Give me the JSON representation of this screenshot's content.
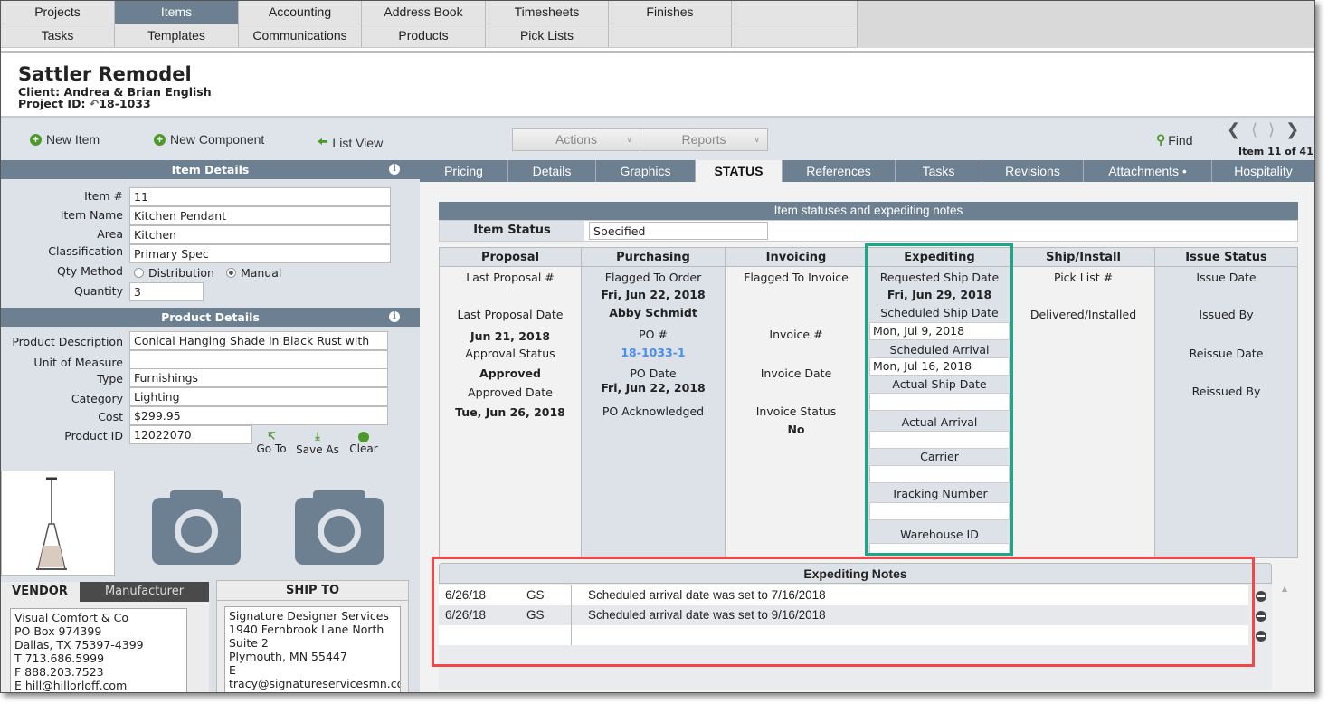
{
  "nav": {
    "row1": [
      "Projects",
      "Items",
      "Accounting",
      "Address Book",
      "Timesheets",
      "Finishes",
      ""
    ],
    "row2": [
      "Tasks",
      "Templates",
      "Communications",
      "Products",
      "Pick Lists",
      "",
      ""
    ],
    "active": "Items"
  },
  "header": {
    "title": "Sattler Remodel",
    "client": "Client: Andrea & Brian English",
    "project_id_label": "Project ID:",
    "project_id": "18-1033"
  },
  "toolbar": {
    "new_item": "New Item",
    "new_component": "New Component",
    "list_view": "List View",
    "actions": "Actions",
    "reports": "Reports",
    "find": "Find",
    "item_counter": "Item 11 of 41"
  },
  "item_details": {
    "title": "Item Details",
    "item_no_label": "Item #",
    "item_no": "11",
    "item_name_label": "Item Name",
    "item_name": "Kitchen Pendant",
    "area_label": "Area",
    "area": "Kitchen",
    "classification_label": "Classification",
    "classification": "Primary Spec",
    "qty_method_label": "Qty Method",
    "qty_options": [
      "Distribution",
      "Manual"
    ],
    "qty_selected": "Manual",
    "quantity_label": "Quantity",
    "quantity": "3"
  },
  "product_details": {
    "title": "Product Details",
    "description_label": "Product Description",
    "description": "Conical Hanging Shade in Black Rust with",
    "uom_label": "Unit of Measure",
    "uom": "",
    "type_label": "Type",
    "type": "Furnishings",
    "category_label": "Category",
    "category": "Lighting",
    "cost_label": "Cost",
    "cost": "$299.95",
    "product_id_label": "Product ID",
    "product_id": "12022070",
    "goto": "Go To",
    "save_as": "Save As",
    "clear": "Clear"
  },
  "vendor": {
    "tab_vendor": "VENDOR",
    "tab_manufacturer": "Manufacturer",
    "lines": [
      "Visual Comfort & Co",
      "PO Box 974399",
      "Dallas, TX 75397-4399",
      "T 713.686.5999",
      "F 888.203.7523",
      "E hill@hillorloff.com"
    ]
  },
  "ship_to": {
    "title": "SHIP TO",
    "lines": [
      "Signature Designer Services",
      "1940 Fernbrook Lane North",
      "Suite 2",
      "Plymouth, MN 55447",
      "E",
      "tracy@signatureservicesmn.co"
    ]
  },
  "tabs": [
    "Pricing",
    "Details",
    "Graphics",
    "STATUS",
    "References",
    "Tasks",
    "Revisions",
    "Attachments •",
    "Hospitality"
  ],
  "status": {
    "title": "Item statuses and expediting notes",
    "item_status_label": "Item Status",
    "item_status": "Specified",
    "proposal": {
      "h": "Proposal",
      "last_proposal_no": "Last Proposal #",
      "last_proposal_date_label": "Last Proposal Date",
      "last_proposal_date": "Jun 21, 2018",
      "approval_status_label": "Approval Status",
      "approval_status": "Approved",
      "approved_date_label": "Approved Date",
      "approved_date": "Tue, Jun 26, 2018"
    },
    "purchasing": {
      "h": "Purchasing",
      "flagged_label": "Flagged To Order",
      "flagged_date": "Fri, Jun 22, 2018",
      "flagged_by": "Abby Schmidt",
      "po_label": "PO #",
      "po": "18-1033-1",
      "po_date_label": "PO Date",
      "po_date": "Fri, Jun 22, 2018",
      "po_ack_label": "PO Acknowledged"
    },
    "invoicing": {
      "h": "Invoicing",
      "flagged_label": "Flagged To Invoice",
      "invoice_no_label": "Invoice #",
      "invoice_date_label": "Invoice Date",
      "invoice_status_label": "Invoice Status",
      "invoice_status": "No"
    },
    "expediting": {
      "h": "Expediting",
      "req_ship_label": "Requested Ship Date",
      "req_ship": "Fri, Jun 29, 2018",
      "sched_ship_label": "Scheduled Ship Date",
      "sched_ship": "Mon, Jul 9, 2018",
      "sched_arrival_label": "Scheduled Arrival",
      "sched_arrival": "Mon, Jul 16, 2018",
      "actual_ship_label": "Actual Ship Date",
      "actual_ship": "",
      "actual_arrival_label": "Actual Arrival",
      "actual_arrival": "",
      "carrier_label": "Carrier",
      "carrier": "",
      "tracking_label": "Tracking Number",
      "tracking": "",
      "warehouse_label": "Warehouse ID",
      "warehouse": ""
    },
    "ship_install": {
      "h": "Ship/Install",
      "pick_list_label": "Pick List #",
      "delivered_label": "Delivered/Installed"
    },
    "issue": {
      "h": "Issue Status",
      "issue_date_label": "Issue Date",
      "issued_by_label": "Issued By",
      "reissue_date_label": "Reissue Date",
      "reissued_by_label": "Reissued By"
    }
  },
  "notes": {
    "title": "Expediting Notes",
    "rows": [
      {
        "date": "6/26/18",
        "user": "GS",
        "text": "Scheduled arrival date was set to  7/16/2018"
      },
      {
        "date": "6/26/18",
        "user": "GS",
        "text": "Scheduled arrival date was set to 9/16/2018"
      },
      {
        "date": "",
        "user": "",
        "text": ""
      }
    ]
  },
  "colors": {
    "accent": "#6c8091",
    "highlight_expediting": "#1aa88a",
    "highlight_notes": "#f04848",
    "link": "#4a8ee8",
    "green_icon": "#4c9a2a"
  }
}
